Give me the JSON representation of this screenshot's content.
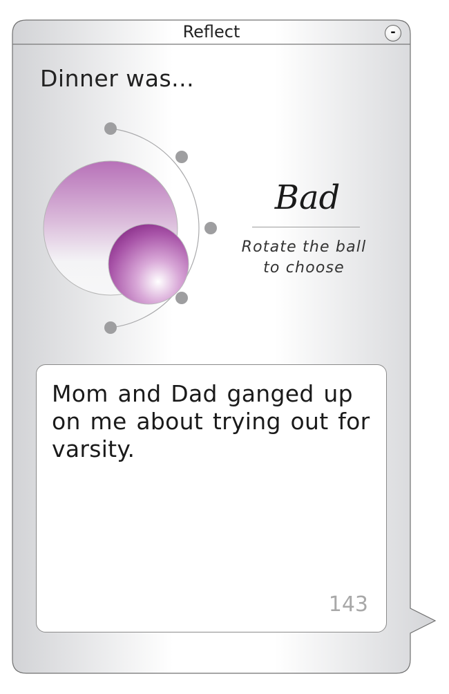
{
  "window": {
    "title": "Reflect",
    "minimize_label": "-"
  },
  "prompt": "Dinner was...",
  "mood": {
    "selected": "Bad",
    "hint_line1": "Rotate the ball",
    "hint_line2": "to choose"
  },
  "entry": {
    "text": "Mom and Dad ganged up on me about trying out for varsity.",
    "remaining_chars": "143"
  },
  "colors": {
    "accent": "#9b3f9c",
    "accent_light": "#cfa4cf",
    "track_dot": "#9e9ea0",
    "panel_edge": "#d2d3d6",
    "panel_center": "#ffffff"
  }
}
